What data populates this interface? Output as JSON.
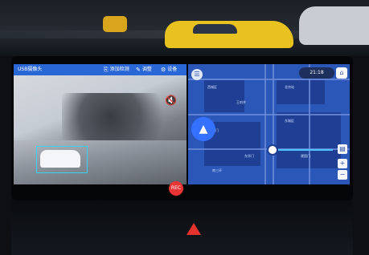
{
  "left_app": {
    "title": "USB摄像头",
    "actions": [
      {
        "icon": "camera-icon",
        "label": "添加检测"
      },
      {
        "icon": "edit-icon",
        "label": "调整"
      },
      {
        "icon": "settings-icon",
        "label": "设备"
      }
    ],
    "rec_label": "REC"
  },
  "right_map": {
    "time": "21:18",
    "labels": [
      "西城区",
      "北京站",
      "东城区",
      "朝阳门",
      "建国门",
      "南三环",
      "王府井",
      "东华门"
    ]
  },
  "colors": {
    "topbar": "#2a67d6",
    "map_bg": "#2b57b8",
    "detect_box": "#37d3ff",
    "hazard": "#e5342e"
  }
}
